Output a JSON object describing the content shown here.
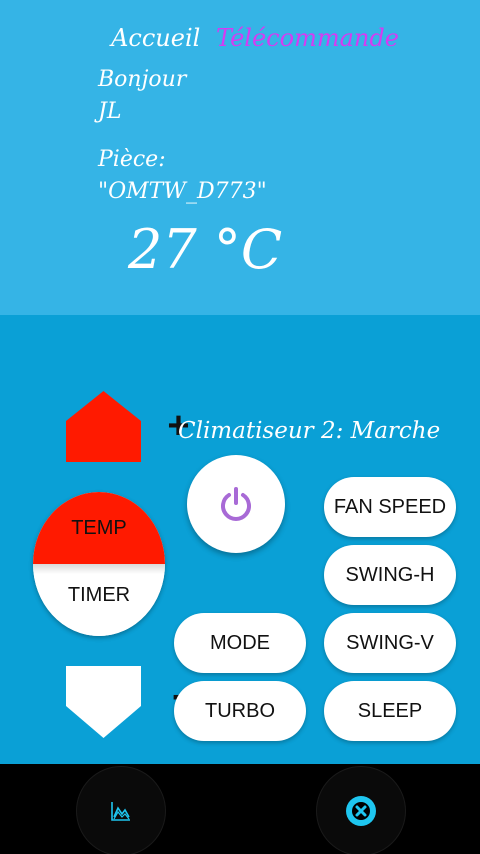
{
  "header": {
    "nav_home": "Accueil",
    "nav_remote": "Télécommande",
    "greeting": "Bonjour",
    "user": "JL",
    "room_label": "Pièce:",
    "room_name": "\"OMTW_D773\"",
    "temperature": "27 °C"
  },
  "controls": {
    "plus_label": "+",
    "minus_label": "-",
    "temp_label": "TEMP",
    "timer_label": "TIMER",
    "status": "Climatiseur 2: Marche",
    "mode_label": "MODE",
    "turbo_label": "TURBO",
    "fan_speed_label": "FAN SPEED",
    "swing_h_label": "SWING-H",
    "swing_v_label": "SWING-V",
    "sleep_label": "SLEEP"
  },
  "bottom_bar": {
    "left_icon": "chart-icon",
    "right_icon": "close-circle-icon"
  },
  "colors": {
    "top_panel": "#35b4e6",
    "bottom_panel": "#0aa0d6",
    "accent_pink": "#d43cf2",
    "temp_red": "#ff1a00",
    "power_purple": "#a86ad6",
    "icon_cyan": "#1ec6f0"
  }
}
